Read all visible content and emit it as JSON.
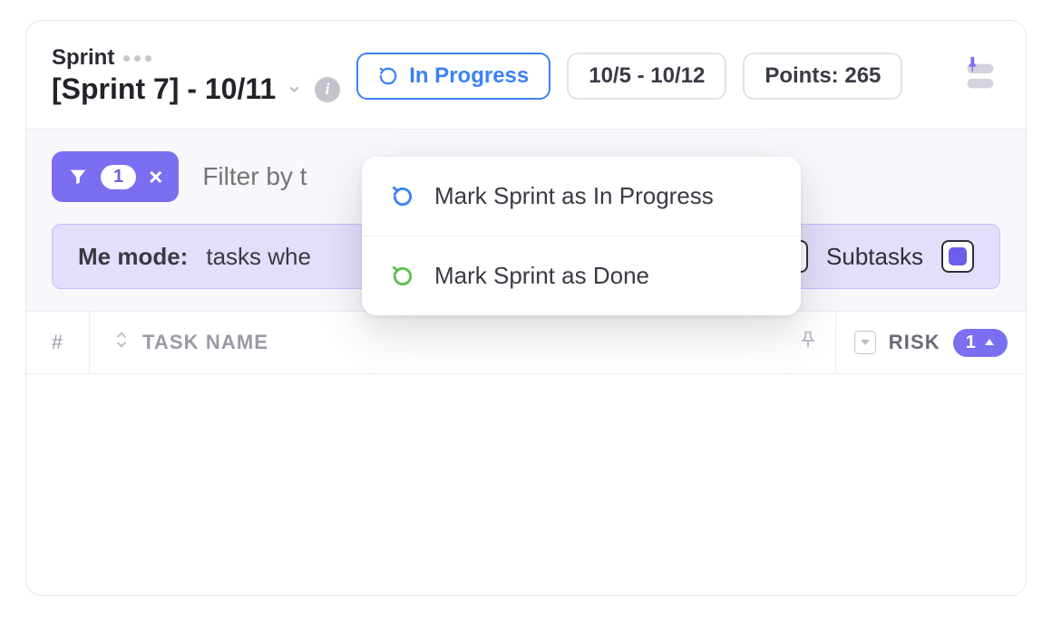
{
  "header": {
    "crumb": "Sprint",
    "title": "[Sprint 7] - 10/11",
    "status_label": "In Progress",
    "date_range": "10/5 - 10/12",
    "points_label": "Points: 265"
  },
  "filter": {
    "count": "1",
    "placeholder": "Filter by t"
  },
  "me_mode": {
    "label": "Me mode:",
    "text": "tasks whe",
    "subtasks_label": "Subtasks"
  },
  "columns": {
    "index": "#",
    "task_name": "TASK NAME",
    "risk": "RISK",
    "risk_count": "1"
  },
  "dropdown": {
    "items": [
      {
        "label": "Mark Sprint as In Progress",
        "color": "#3b82f6"
      },
      {
        "label": "Mark Sprint as Done",
        "color": "#5bbf4c"
      }
    ]
  }
}
